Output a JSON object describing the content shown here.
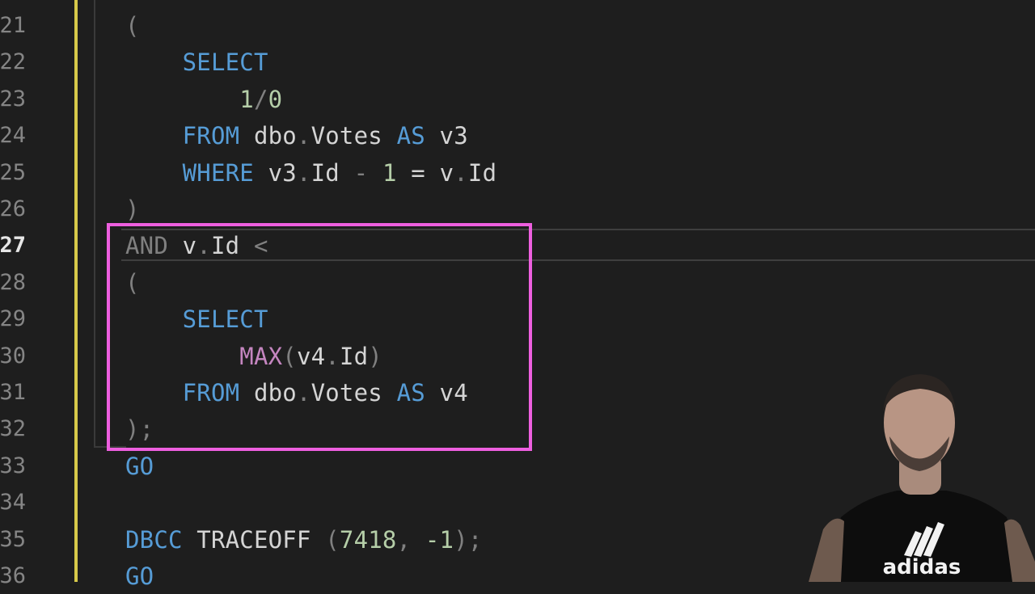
{
  "editor": {
    "line_numbers": [
      "21",
      "22",
      "23",
      "24",
      "25",
      "26",
      "27",
      "28",
      "29",
      "30",
      "31",
      "32",
      "33",
      "34",
      "35",
      "36"
    ],
    "active_line": "27",
    "lines": [
      [
        {
          "t": "(",
          "c": "op"
        }
      ],
      [
        {
          "t": "    ",
          "c": "id"
        },
        {
          "t": "SELECT",
          "c": "kw"
        }
      ],
      [
        {
          "t": "        ",
          "c": "id"
        },
        {
          "t": "1",
          "c": "num"
        },
        {
          "t": "/",
          "c": "op"
        },
        {
          "t": "0",
          "c": "num"
        }
      ],
      [
        {
          "t": "    ",
          "c": "id"
        },
        {
          "t": "FROM",
          "c": "kw"
        },
        {
          "t": " dbo",
          "c": "id"
        },
        {
          "t": ".",
          "c": "op"
        },
        {
          "t": "Votes ",
          "c": "id"
        },
        {
          "t": "AS",
          "c": "kw"
        },
        {
          "t": " v3",
          "c": "id"
        }
      ],
      [
        {
          "t": "    ",
          "c": "id"
        },
        {
          "t": "WHERE",
          "c": "kw"
        },
        {
          "t": " v3",
          "c": "id"
        },
        {
          "t": ".",
          "c": "op"
        },
        {
          "t": "Id ",
          "c": "id"
        },
        {
          "t": "-",
          "c": "op"
        },
        {
          "t": " ",
          "c": "id"
        },
        {
          "t": "1",
          "c": "num"
        },
        {
          "t": " = v",
          "c": "id"
        },
        {
          "t": ".",
          "c": "op"
        },
        {
          "t": "Id",
          "c": "id"
        }
      ],
      [
        {
          "t": ")",
          "c": "op"
        }
      ],
      [
        {
          "t": "AND",
          "c": "op"
        },
        {
          "t": " v",
          "c": "id"
        },
        {
          "t": ".",
          "c": "op"
        },
        {
          "t": "Id ",
          "c": "id"
        },
        {
          "t": "<",
          "c": "op"
        }
      ],
      [
        {
          "t": "(",
          "c": "op"
        }
      ],
      [
        {
          "t": "    ",
          "c": "id"
        },
        {
          "t": "SELECT",
          "c": "kw"
        }
      ],
      [
        {
          "t": "        ",
          "c": "id"
        },
        {
          "t": "MAX",
          "c": "fn"
        },
        {
          "t": "(",
          "c": "op"
        },
        {
          "t": "v4",
          "c": "id"
        },
        {
          "t": ".",
          "c": "op"
        },
        {
          "t": "Id",
          "c": "id"
        },
        {
          "t": ")",
          "c": "op"
        }
      ],
      [
        {
          "t": "    ",
          "c": "id"
        },
        {
          "t": "FROM",
          "c": "kw"
        },
        {
          "t": " dbo",
          "c": "id"
        },
        {
          "t": ".",
          "c": "op"
        },
        {
          "t": "Votes ",
          "c": "id"
        },
        {
          "t": "AS",
          "c": "kw"
        },
        {
          "t": " v4",
          "c": "id"
        }
      ],
      [
        {
          "t": ");",
          "c": "op"
        }
      ],
      [
        {
          "t": "GO",
          "c": "kw"
        }
      ],
      [],
      [
        {
          "t": "DBCC",
          "c": "kw"
        },
        {
          "t": " TRACEOFF ",
          "c": "id"
        },
        {
          "t": "(",
          "c": "op"
        },
        {
          "t": "7418",
          "c": "num"
        },
        {
          "t": ", ",
          "c": "op"
        },
        {
          "t": "-1",
          "c": "num"
        },
        {
          "t": ");",
          "c": "op"
        }
      ],
      [
        {
          "t": "GO",
          "c": "kw"
        }
      ]
    ]
  },
  "colors": {
    "background": "#1e1e1e",
    "keyword": "#569cd6",
    "number": "#b5cea8",
    "function": "#c586c0",
    "highlight_box": "#ee5fdf",
    "gutter_bar": "#d7c94a"
  },
  "overlay": {
    "webcam_icon": "presenter-webcam",
    "shirt_text": "adidas"
  }
}
